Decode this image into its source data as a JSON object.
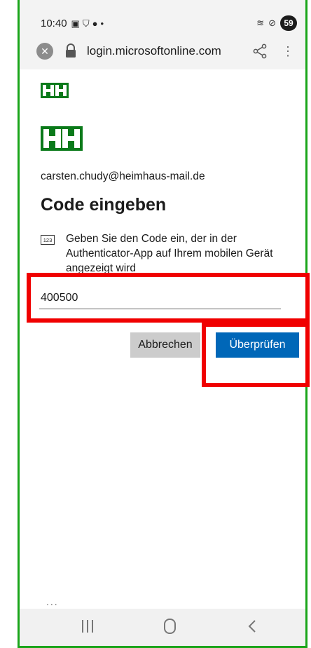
{
  "status": {
    "time": "10:40",
    "battery": "59"
  },
  "browser": {
    "url": "login.microsoftonline.com"
  },
  "page": {
    "email": "carsten.chudy@heimhaus-mail.de",
    "heading": "Code eingeben",
    "instruction": "Geben Sie den Code ein, der in der Authenticator-App auf Ihrem mobilen Gerät angezeigt wird",
    "code_icon_text": "123",
    "code_value": "400500",
    "cancel_label": "Abbrechen",
    "verify_label": "Überprüfen",
    "more_dots": "..."
  },
  "colors": {
    "frame_border": "#1aa51a",
    "highlight": "#f00000",
    "verify_button": "#0067b8",
    "cancel_button": "#cccccc",
    "logo": "#0a7a1a"
  }
}
